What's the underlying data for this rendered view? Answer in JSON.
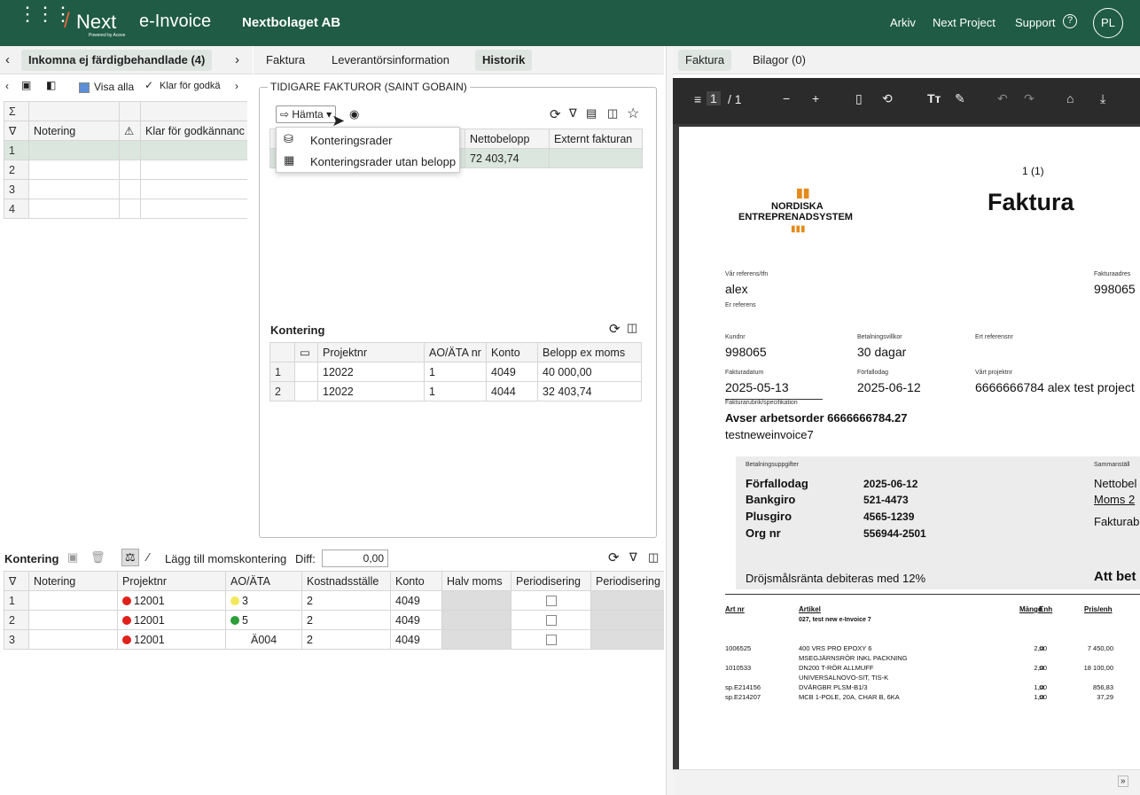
{
  "topbar": {
    "brand": "Next",
    "brand2": "e-Invoice",
    "powered": "Powered by Acove",
    "company": "Nextbolaget AB",
    "nav": [
      "Arkiv",
      "Next Project",
      "Support"
    ],
    "avatar": "PL",
    "bg": "#1f5b45"
  },
  "left": {
    "tab": "Inkomna ej färdigbehandlade (4)",
    "visa_alla": "Visa alla",
    "klar": "Klar för godkä",
    "sigma": "Σ",
    "headers": [
      "Notering",
      "Klar för godkännanc"
    ],
    "rows": [
      "1",
      "2",
      "3",
      "4"
    ]
  },
  "mid": {
    "tabs": [
      "Faktura",
      "Leverantörsinformation",
      "Historik"
    ],
    "section": "TIDIGARE FAKTUROR (SAINT GOBAIN)",
    "hamta": "Hämta",
    "menu": [
      "Konteringsrader",
      "Konteringsrader utan belopp"
    ],
    "inv_headers": [
      "Nettobelopp",
      "Externt fakturan"
    ],
    "inv_amount": "72 403,74",
    "kontering_title": "Kontering",
    "k_headers": [
      "Projektnr",
      "AO/ÄTA nr",
      "Konto",
      "Belopp ex moms"
    ],
    "k_rows": [
      {
        "n": "1",
        "p": "12022",
        "ao": "1",
        "k": "4049",
        "b": "40 000,00"
      },
      {
        "n": "2",
        "p": "12022",
        "ao": "1",
        "k": "4044",
        "b": "32 403,74"
      }
    ]
  },
  "bottom": {
    "title": "Kontering",
    "add": "Lägg till momskontering",
    "diff_label": "Diff:",
    "diff": "0,00",
    "headers": [
      "Notering",
      "Projektnr",
      "AO/ÄTA",
      "Kostnadsställe",
      "Konto",
      "Halv moms",
      "Periodisering",
      "Periodisering"
    ],
    "rows": [
      {
        "n": "1",
        "p": "12001",
        "ao": "3",
        "aoc": "#f2e85a",
        "ks": "2",
        "k": "4049"
      },
      {
        "n": "2",
        "p": "12001",
        "ao": "5",
        "aoc": "#2e9d3a",
        "ks": "2",
        "k": "4049"
      },
      {
        "n": "3",
        "p": "12001",
        "ao": "Ä004",
        "aoc": "",
        "ks": "2",
        "k": "4049"
      }
    ]
  },
  "right": {
    "tabs": [
      "Faktura",
      "Bilagor (0)"
    ],
    "page": "1",
    "of": "/ 1"
  },
  "pdf": {
    "pagenum": "1 (1)",
    "title": "Faktura",
    "logo1": "NORDISKA",
    "logo2": "ENTREPRENADSYSTEM",
    "var_ref_l": "Vår referens/tfn",
    "var_ref": "alex",
    "er_ref_l": "Er referens",
    "fa_l": "Fakturaadres",
    "fa": "998065",
    "kundnr_l": "Kundnr",
    "kundnr": "998065",
    "bv_l": "Betalningsvillkor",
    "bv": "30 dagar",
    "ert_l": "Ert referensnr",
    "fd_l": "Fakturadatum",
    "fd": "2025-05-13",
    "ff_l": "Förfallodag",
    "ff": "2025-06-12",
    "vp_l": "Vårt projektnr",
    "vp": "6666666784 alex test project",
    "rub_l": "Fakturarubrik/specifikation",
    "rub": "Avser arbetsorder 6666666784.27",
    "rub2": "testneweinvoice7",
    "bu_l": "Betalningsuppgifter",
    "sam_l": "Sammanställ",
    "pay": [
      [
        "Förfallodag",
        "2025-06-12"
      ],
      [
        "Bankgiro",
        "521-4473"
      ],
      [
        "Plusgiro",
        "4565-1239"
      ],
      [
        "Org nr",
        "556944-2501"
      ]
    ],
    "sam": [
      "Nettobel",
      "Moms 2",
      "Fakturab"
    ],
    "drojs": "Dröjsmålsränta debiteras med 12%",
    "att": "Att bet",
    "cols": [
      "Art nr",
      "Artikel",
      "Mängd",
      "Enh",
      "Pris/enh"
    ],
    "sub": "027, test new e-Invoice 7",
    "lines": [
      [
        "1006525",
        "400 VRS PRO EPOXY 6",
        "2,00",
        "st",
        "7 450,00"
      ],
      [
        "",
        "MSEGJÄRNSRÖR INKL PACKNING",
        "",
        "",
        ""
      ],
      [
        "1010533",
        "DN200 T-RÖR ALLMUFF",
        "2,00",
        "st",
        "18 100,00"
      ],
      [
        "",
        "UNIVERSALNOVO-SIT, TIS-K",
        "",
        "",
        ""
      ],
      [
        "sp.E214156",
        "DVÄRGBR PLSM-B1/3",
        "1,00",
        "st",
        "856,83"
      ],
      [
        "sp.E214207",
        "MCB 1-POLE, 20A, CHAR B, 6KA",
        "1,00",
        "st",
        "37,29"
      ]
    ]
  }
}
